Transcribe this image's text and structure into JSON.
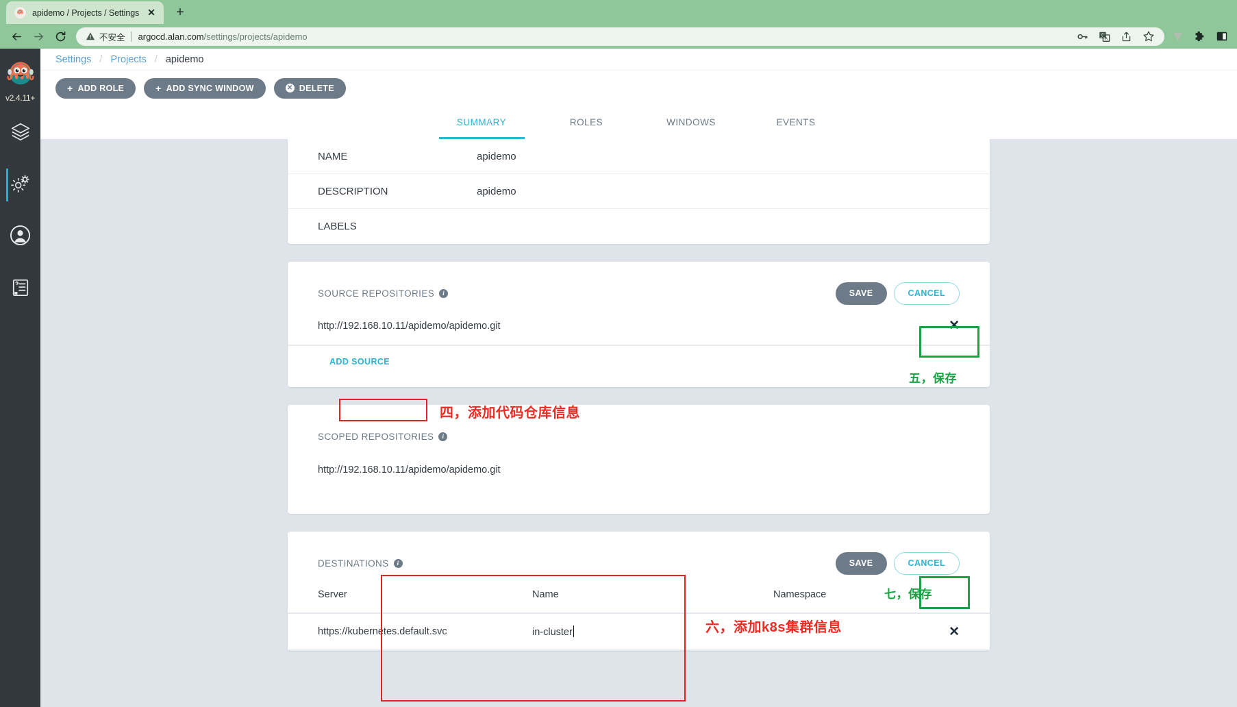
{
  "browser": {
    "tab": {
      "title": "apidemo / Projects / Settings -",
      "favicon_icon": "argocd-octopus-icon",
      "close_icon": "close-icon"
    },
    "new_tab_icon": "plus-icon",
    "nav": {
      "back_icon": "back-arrow-icon",
      "forward_icon": "forward-arrow-icon",
      "reload_icon": "reload-icon"
    },
    "omnibox": {
      "warning_icon": "warning-triangle-icon",
      "not_secure_label": "不安全",
      "url_host": "argocd.alan.com",
      "url_path": "/settings/projects/apidemo"
    },
    "toolbar_icons": [
      "key-icon",
      "translate-icon",
      "share-icon",
      "bookmark-star-icon",
      "v-extension-icon",
      "puzzle-extension-icon",
      "sidebar-panel-icon"
    ]
  },
  "sidebar": {
    "version": "v2.4.11+",
    "logo_icon": "argocd-octopus-logo",
    "items": [
      {
        "name": "applications",
        "icon": "layers-icon",
        "active": false
      },
      {
        "name": "settings",
        "icon": "gears-icon",
        "active": true
      },
      {
        "name": "user-info",
        "icon": "user-circle-icon",
        "active": false
      },
      {
        "name": "documentation",
        "icon": "book-help-icon",
        "active": false
      }
    ]
  },
  "breadcrumb": {
    "items": [
      {
        "label": "Settings",
        "current": false
      },
      {
        "label": "Projects",
        "current": false
      },
      {
        "label": "apidemo",
        "current": true
      }
    ],
    "separator": "/"
  },
  "actions": [
    {
      "label": "ADD ROLE",
      "icon": "plus-icon"
    },
    {
      "label": "ADD SYNC WINDOW",
      "icon": "plus-icon"
    },
    {
      "label": "DELETE",
      "icon": "x-circle-icon"
    }
  ],
  "tabs": [
    {
      "label": "SUMMARY",
      "active": true
    },
    {
      "label": "ROLES",
      "active": false
    },
    {
      "label": "WINDOWS",
      "active": false
    },
    {
      "label": "EVENTS",
      "active": false
    }
  ],
  "summary": {
    "fields": [
      {
        "key": "NAME",
        "value": "apidemo"
      },
      {
        "key": "DESCRIPTION",
        "value": "apidemo"
      },
      {
        "key": "LABELS",
        "value": ""
      }
    ]
  },
  "source_repositories": {
    "title": "SOURCE REPOSITORIES",
    "info_icon": "info-icon",
    "save_label": "SAVE",
    "cancel_label": "CANCEL",
    "rows": [
      {
        "url": "http://192.168.10.11/apidemo/apidemo.git",
        "delete_icon": "close-icon"
      }
    ],
    "add_label": "ADD SOURCE"
  },
  "scoped_repositories": {
    "title": "SCOPED REPOSITORIES",
    "info_icon": "info-icon",
    "rows": [
      {
        "url": "http://192.168.10.11/apidemo/apidemo.git"
      }
    ]
  },
  "destinations": {
    "title": "DESTINATIONS",
    "info_icon": "info-icon",
    "save_label": "SAVE",
    "cancel_label": "CANCEL",
    "columns": [
      "Server",
      "Name",
      "Namespace"
    ],
    "rows": [
      {
        "server": "https://kubernetes.default.svc",
        "name": "in-cluster",
        "namespace": "*",
        "delete_icon": "close-icon"
      }
    ]
  },
  "annotations": [
    {
      "id": "anno-4",
      "text": "四，添加代码仓库信息",
      "color": "#ef2b24"
    },
    {
      "id": "anno-5",
      "text": "五，保存",
      "color": "#1aa245"
    },
    {
      "id": "anno-6",
      "text": "六，添加k8s集群信息",
      "color": "#ef2b24"
    },
    {
      "id": "anno-7",
      "text": "七，保存",
      "color": "#1aa245"
    }
  ],
  "colors": {
    "accent": "#29b6d4",
    "button_gray": "#6d7b88",
    "page_bg": "#dfe4ea",
    "sidebar_bg": "#33383d",
    "browser_green": "#8fc79a",
    "anno_red": "#ef2b24",
    "anno_green": "#1aa245"
  }
}
